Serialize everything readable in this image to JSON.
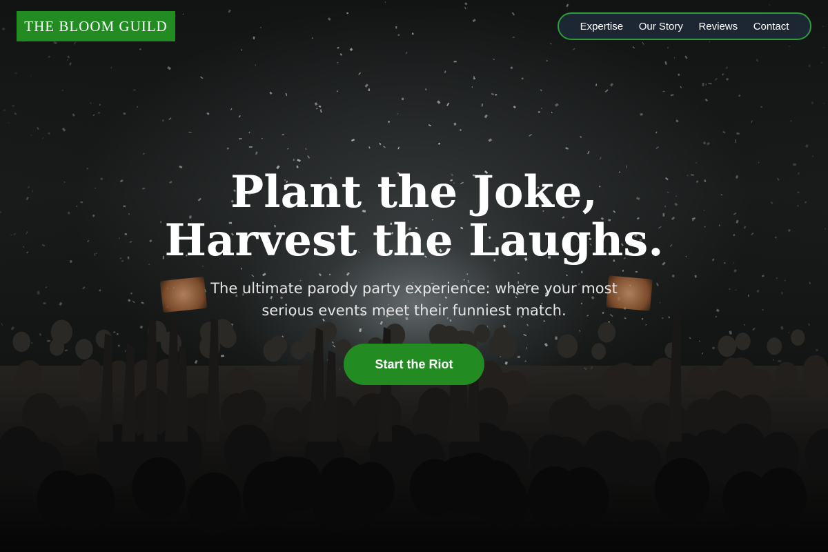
{
  "brand": {
    "name": "THE BLOOM GUILD",
    "color": "#228b22"
  },
  "nav": {
    "items": [
      {
        "label": "Expertise"
      },
      {
        "label": "Our Story"
      },
      {
        "label": "Reviews"
      },
      {
        "label": "Contact"
      }
    ],
    "border_color": "#2e9e3a",
    "background": "#1c2733"
  },
  "hero": {
    "headline_line1": "Plant the Joke,",
    "headline_line2": "Harvest the Laughs.",
    "subtitle_line1": "The ultimate parody party experience: where your most",
    "subtitle_line2": "serious events meet their funniest match.",
    "cta_label": "Start the Riot",
    "background_image": "concert crowd with confetti"
  }
}
